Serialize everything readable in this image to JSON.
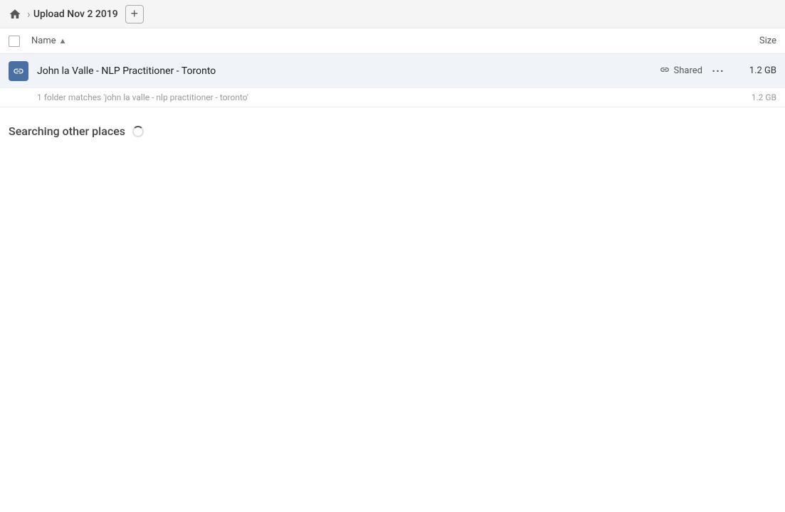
{
  "breadcrumb": {
    "home_label": "Home",
    "current_folder": "Upload Nov 2 2019",
    "add_button_label": "+"
  },
  "columns": {
    "name_label": "Name",
    "size_label": "Size"
  },
  "file_row": {
    "name": "John la Valle - NLP Practitioner - Toronto",
    "shared_label": "Shared",
    "size": "1.2 GB",
    "more_icon": "···"
  },
  "match_info": {
    "text": "1 folder matches 'john la valle - nlp practitioner - toronto'",
    "size": "1.2 GB"
  },
  "searching": {
    "label": "Searching other places"
  }
}
